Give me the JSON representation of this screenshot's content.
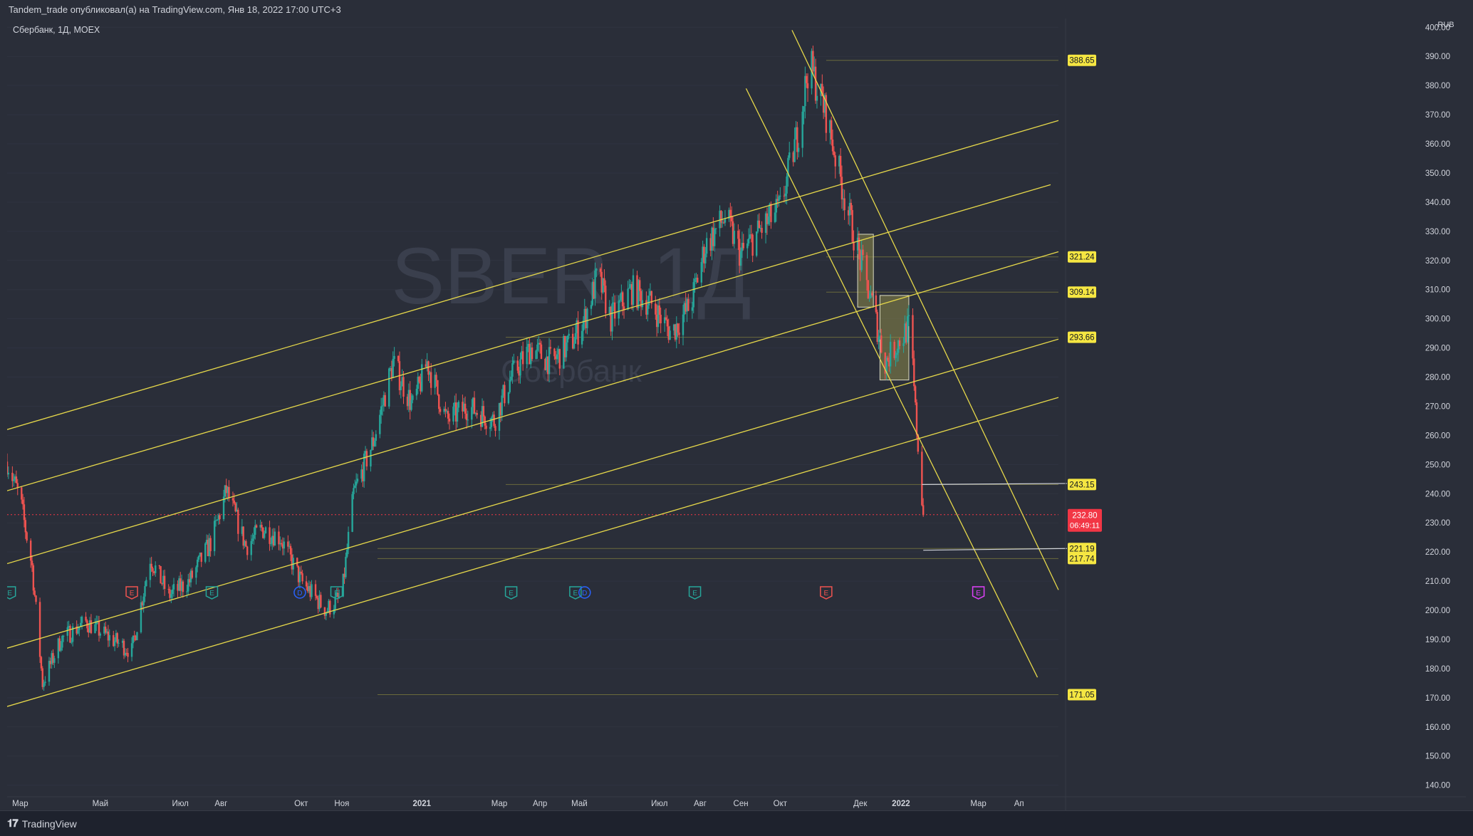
{
  "header": {
    "publish_line": "Tandem_trade опубликовал(а) на TradingView.com, Янв 18, 2022 17:00 UTC+3"
  },
  "symbol": {
    "legend": "Сбербанк, 1Д, MOEX",
    "watermark_ticker": "SBER, 1Д",
    "watermark_name": "Сбербанк"
  },
  "footer": {
    "brand": "TradingView",
    "brand_icon": "tradingview-logo-icon"
  },
  "colors": {
    "background": "#2a2e39",
    "up": "#26a69a",
    "down": "#ef5350",
    "channel": "#e6d84a",
    "level_label_bg": "#f5e642",
    "price_label_bg": "#f23645",
    "zone_fill": "#8c8a4a"
  },
  "chart_data": {
    "type": "candlestick",
    "title": "",
    "currency": "RUB",
    "y_ticks": [
      140,
      150,
      160,
      170,
      180,
      190,
      200,
      210,
      220,
      230,
      240,
      250,
      260,
      270,
      280,
      290,
      300,
      310,
      320,
      330,
      340,
      350,
      360,
      370,
      380,
      390,
      400
    ],
    "ylim": [
      136,
      403
    ],
    "x_ticks": [
      "Мар",
      "Май",
      "Июл",
      "Авг",
      "Окт",
      "Ноя",
      "2021",
      "Мар",
      "Апр",
      "Май",
      "Июл",
      "Авг",
      "Сен",
      "Окт",
      "Дек",
      "2022",
      "Мар",
      "Ап"
    ],
    "x_tick_bold": [
      "2021",
      "2022"
    ],
    "price_path": [
      [
        "2020-02-20",
        251
      ],
      [
        "2020-03-01",
        238
      ],
      [
        "2020-03-10",
        215
      ],
      [
        "2020-03-18",
        175
      ],
      [
        "2020-04-01",
        190
      ],
      [
        "2020-04-20",
        196
      ],
      [
        "2020-05-10",
        190
      ],
      [
        "2020-05-25",
        186
      ],
      [
        "2020-06-08",
        218
      ],
      [
        "2020-06-22",
        205
      ],
      [
        "2020-07-08",
        210
      ],
      [
        "2020-07-25",
        224
      ],
      [
        "2020-08-05",
        241
      ],
      [
        "2020-08-20",
        222
      ],
      [
        "2020-09-01",
        228
      ],
      [
        "2020-09-15",
        225
      ],
      [
        "2020-10-01",
        210
      ],
      [
        "2020-10-20",
        200
      ],
      [
        "2020-11-01",
        205
      ],
      [
        "2020-11-10",
        240
      ],
      [
        "2020-11-25",
        258
      ],
      [
        "2020-12-10",
        285
      ],
      [
        "2020-12-25",
        270
      ],
      [
        "2021-01-05",
        285
      ],
      [
        "2021-01-20",
        265
      ],
      [
        "2021-02-05",
        270
      ],
      [
        "2021-02-25",
        265
      ],
      [
        "2021-03-10",
        280
      ],
      [
        "2021-03-25",
        290
      ],
      [
        "2021-04-10",
        285
      ],
      [
        "2021-04-25",
        292
      ],
      [
        "2021-05-05",
        300
      ],
      [
        "2021-05-15",
        315
      ],
      [
        "2021-05-25",
        300
      ],
      [
        "2021-06-10",
        310
      ],
      [
        "2021-06-25",
        305
      ],
      [
        "2021-07-10",
        295
      ],
      [
        "2021-07-25",
        305
      ],
      [
        "2021-08-05",
        325
      ],
      [
        "2021-08-20",
        335
      ],
      [
        "2021-09-01",
        322
      ],
      [
        "2021-09-15",
        330
      ],
      [
        "2021-10-01",
        338
      ],
      [
        "2021-10-15",
        365
      ],
      [
        "2021-10-23",
        388
      ],
      [
        "2021-11-05",
        370
      ],
      [
        "2021-11-20",
        340
      ],
      [
        "2021-12-01",
        320
      ],
      [
        "2021-12-10",
        305
      ],
      [
        "2021-12-20",
        285
      ],
      [
        "2021-12-30",
        292
      ],
      [
        "2022-01-08",
        298
      ],
      [
        "2022-01-12",
        268
      ],
      [
        "2022-01-18",
        232.8
      ]
    ],
    "horizontal_levels": [
      388.65,
      321.24,
      309.14,
      293.66,
      243.15,
      221.19,
      217.74,
      171.05
    ],
    "current_price": "232.80",
    "countdown": "06:49:11",
    "channel_lines": [
      {
        "x1": "2020-02-20",
        "y1": 262,
        "x2": "2022-05-01",
        "y2": 368
      },
      {
        "x1": "2020-02-20",
        "y1": 241,
        "x2": "2022-04-25",
        "y2": 346
      },
      {
        "x1": "2020-02-20",
        "y1": 216,
        "x2": "2022-05-01",
        "y2": 323
      },
      {
        "x1": "2020-02-20",
        "y1": 187,
        "x2": "2022-05-01",
        "y2": 293
      },
      {
        "x1": "2020-02-20",
        "y1": 167,
        "x2": "2022-05-01",
        "y2": 273
      },
      {
        "x1": "2021-09-05",
        "y1": 379,
        "x2": "2022-04-15",
        "y2": 177
      },
      {
        "x1": "2021-10-10",
        "y1": 399,
        "x2": "2022-05-01",
        "y2": 207
      }
    ],
    "zones": [
      {
        "x1": "2021-11-29",
        "y1": 304,
        "x2": "2021-12-11",
        "y2": 329
      },
      {
        "x1": "2021-12-16",
        "y1": 279,
        "x2": "2022-01-07",
        "y2": 308
      }
    ],
    "event_markers": [
      {
        "date": "2020-02-22",
        "label": "E",
        "kind": "dividend-green"
      },
      {
        "date": "2020-05-25",
        "label": "E",
        "kind": "earnings-red"
      },
      {
        "date": "2020-07-25",
        "label": "E",
        "kind": "dividend-green"
      },
      {
        "date": "2020-09-30",
        "label": "D",
        "kind": "dividend-blue"
      },
      {
        "date": "2020-10-28",
        "label": "E",
        "kind": "dividend-green"
      },
      {
        "date": "2021-03-10",
        "label": "E",
        "kind": "dividend-green"
      },
      {
        "date": "2021-04-28",
        "label": "E",
        "kind": "dividend-green"
      },
      {
        "date": "2021-05-05",
        "label": "D",
        "kind": "dividend-blue"
      },
      {
        "date": "2021-07-28",
        "label": "E",
        "kind": "dividend-green"
      },
      {
        "date": "2021-11-05",
        "label": "E",
        "kind": "earnings-red"
      },
      {
        "date": "2022-03-01",
        "label": "E",
        "kind": "earnings-purple"
      }
    ]
  }
}
